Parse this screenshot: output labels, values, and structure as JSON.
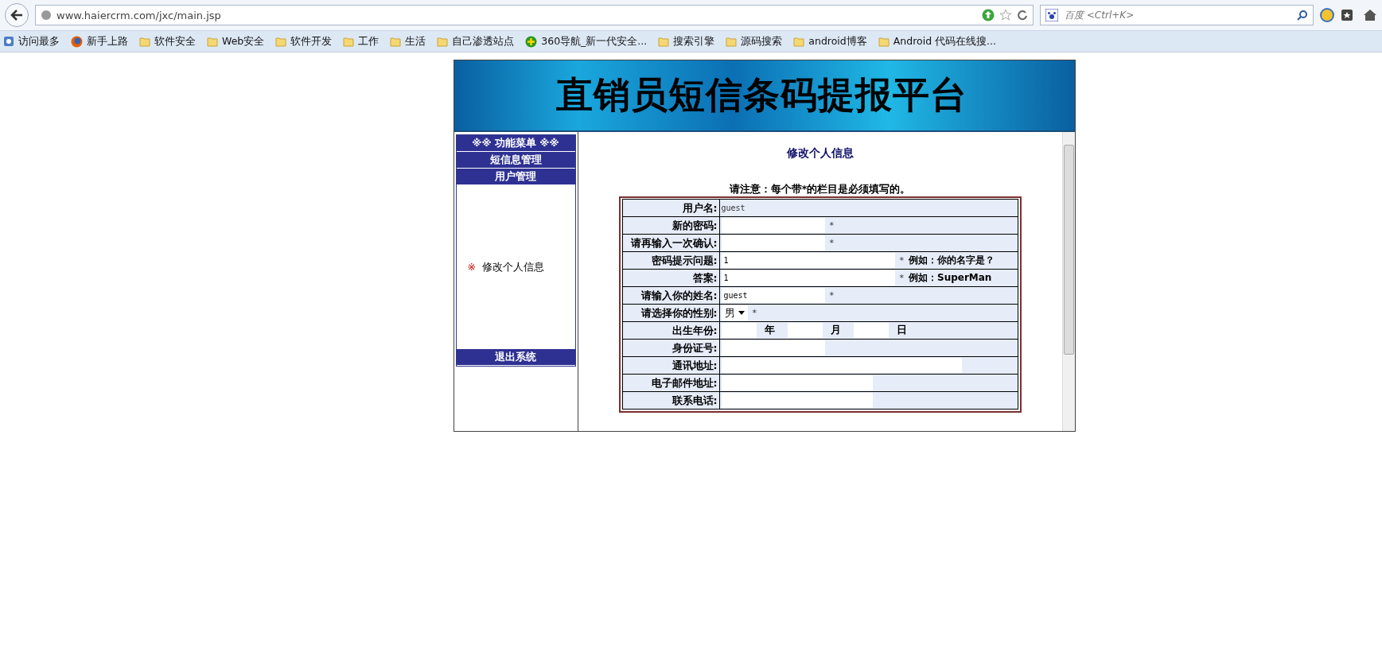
{
  "browser": {
    "url": "www.haiercrm.com/jxc/main.jsp",
    "search": {
      "placeholder": "百度 <Ctrl+K>"
    },
    "bookmarks": [
      {
        "kind": "most",
        "label": "访问最多"
      },
      {
        "kind": "firefox",
        "label": "新手上路"
      },
      {
        "kind": "folder",
        "label": "软件安全"
      },
      {
        "kind": "folder",
        "label": "Web安全"
      },
      {
        "kind": "folder",
        "label": "软件开发"
      },
      {
        "kind": "folder",
        "label": "工作"
      },
      {
        "kind": "folder",
        "label": "生活"
      },
      {
        "kind": "folder",
        "label": "自己渗透站点"
      },
      {
        "kind": "plus",
        "label": "360导航_新一代安全..."
      },
      {
        "kind": "folder",
        "label": "搜索引擎"
      },
      {
        "kind": "folder",
        "label": "源码搜索"
      },
      {
        "kind": "folder",
        "label": "android博客"
      },
      {
        "kind": "folder",
        "label": "Android 代码在线搜..."
      }
    ]
  },
  "banner": {
    "title": "直销员短信条码提报平台"
  },
  "menu": {
    "header": "※※ 功能菜单 ※※",
    "sections": [
      "短信息管理",
      "用户管理"
    ],
    "items": [
      {
        "mark": "※",
        "label": "修改个人信息"
      }
    ],
    "footer": "退出系统"
  },
  "form": {
    "title": "修改个人信息",
    "notice": "请注意：每个带*的栏目是必须填写的。",
    "star": "*",
    "rows": [
      {
        "label": "用户名:",
        "kind": "static",
        "value": "guest",
        "required": false
      },
      {
        "label": "新的密码:",
        "kind": "input",
        "required": true
      },
      {
        "label": "请再输入一次确认:",
        "kind": "input",
        "required": true
      },
      {
        "label": "密码提示问题:",
        "kind": "input",
        "value": "1",
        "required": true,
        "hint": "例如：你的名字是？"
      },
      {
        "label": "答案:",
        "kind": "input",
        "value": "1",
        "required": true,
        "hint": "例如：SuperMan"
      },
      {
        "label": "请输入你的姓名:",
        "kind": "input",
        "value": "guest",
        "required": true
      },
      {
        "label": "请选择你的性别:",
        "kind": "select",
        "value": "男",
        "required": true
      },
      {
        "label": "出生年份:",
        "kind": "date",
        "units": [
          "年",
          "月",
          "日"
        ],
        "required": false
      },
      {
        "label": "身份证号:",
        "kind": "input",
        "required": false
      },
      {
        "label": "通讯地址:",
        "kind": "input",
        "required": false
      },
      {
        "label": "电子邮件地址:",
        "kind": "input",
        "required": false
      },
      {
        "label": "联系电话:",
        "kind": "input",
        "required": false
      }
    ]
  }
}
